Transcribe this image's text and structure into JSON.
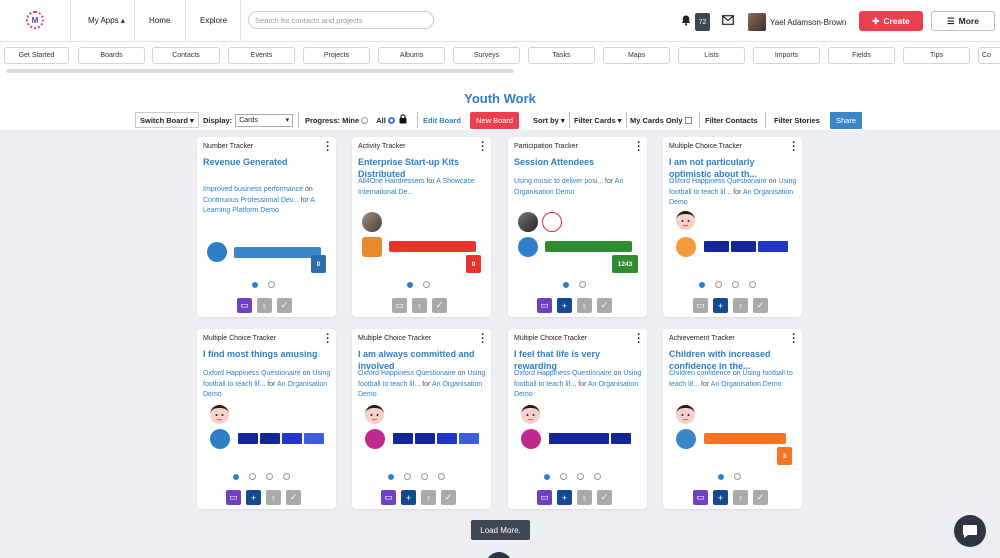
{
  "topbar": {
    "logo_letter": "M",
    "nav": [
      "My Apps ▴",
      "Home",
      "Explore"
    ],
    "search_placeholder": "Search for contacts and projects",
    "notifications": "72",
    "user_name": "Yael Adamson-Brown",
    "create_label": "Create",
    "more_label": "More"
  },
  "tabs": [
    "Get Started",
    "Boards",
    "Contacts",
    "Events",
    "Projects",
    "Albums",
    "Surveys",
    "Tasks",
    "Maps",
    "Lists",
    "Imports",
    "Fields",
    "Tips",
    "Co"
  ],
  "board": {
    "title": "Youth Work",
    "switch_board": "Switch Board ▾",
    "display_label": "Display:",
    "display_value": "Cards",
    "progress_label": "Progress: Mine",
    "progress_all": "All",
    "edit_board": "Edit Board",
    "new_board": "New Board",
    "sort_by": "Sort by ▾",
    "filter_cards": "Filter Cards ▾",
    "my_cards_only": "My Cards Only",
    "filter_contacts": "Filter Contacts",
    "filter_stories": "Filter Stories",
    "share": "Share"
  },
  "cards": [
    {
      "type": "Number Tracker",
      "title": "Revenue Generated",
      "desc": "Improved business performance",
      "on": " on ",
      "link1": "Continuous Professional Dev...",
      "for": " for ",
      "link2": "A Learning Platform Demo",
      "badge": "0"
    },
    {
      "type": "Activity Tracker",
      "title": "Enterprise Start-up Kits Distributed",
      "desc": "All4One Hairdressers",
      "on": " for ",
      "link1": "A Showcase International De...",
      "for": "",
      "link2": "",
      "badge": "0"
    },
    {
      "type": "Participation Tracker",
      "title": "Session Attendees",
      "desc": "Using music to deliver posi...",
      "on": " for ",
      "link1": "An Organisation Demo",
      "for": "",
      "link2": "",
      "badge": "1243"
    },
    {
      "type": "Multiple Choice Tracker",
      "title": "I am not particularly optimistic about th...",
      "desc": "Oxford Happiness Questionaire",
      "on": " on ",
      "link1": "Using football to teach lif...",
      "for": " for ",
      "link2": "An Organisation Demo",
      "badge": ""
    },
    {
      "type": "Multiple Choice Tracker",
      "title": "I find most things amusing",
      "desc": "Oxford Happiness Questionaire",
      "on": " on ",
      "link1": "Using football to teach lif...",
      "for": " for ",
      "link2": "An Organisation Demo",
      "badge": ""
    },
    {
      "type": "Multiple Choice Tracker",
      "title": "I am always committed and involved",
      "desc": "Oxford Happiness Questionaire",
      "on": " on ",
      "link1": "Using football to teach lif...",
      "for": " for ",
      "link2": "An Organisation Demo",
      "badge": ""
    },
    {
      "type": "Multiple Choice Tracker",
      "title": "I feel that life is very rewarding",
      "desc": "Oxford Happiness Questionaire",
      "on": " on ",
      "link1": "Using football to teach lif...",
      "for": " for ",
      "link2": "An Organisation Demo",
      "badge": ""
    },
    {
      "type": "Achievement Tracker",
      "title": "Children with increased confidence in the...",
      "desc": "Children confidence",
      "on": " on ",
      "link1": "Using football to teach lif...",
      "for": " for ",
      "link2": "An Organisation Demo",
      "badge": "3"
    }
  ],
  "load_more": "Load More.",
  "colors": {
    "accent": "#2d80c6",
    "create": "#e9404f",
    "dark": "#3e4553",
    "purple": "#6f42c1",
    "navy": "#15488f"
  }
}
